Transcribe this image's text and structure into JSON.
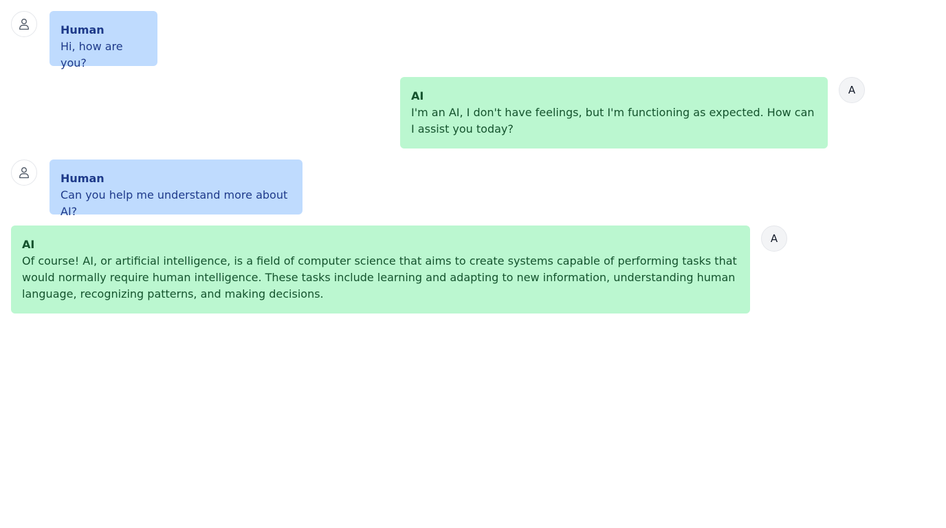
{
  "messages": [
    {
      "role": "human",
      "sender": "Human",
      "text": "Hi, how are you?",
      "avatar_icon": "user-icon"
    },
    {
      "role": "ai",
      "sender": "AI",
      "text": "I'm an AI, I don't have feelings, but I'm functioning as expected. How can I assist you today?",
      "avatar_letter": "A"
    },
    {
      "role": "human",
      "sender": "Human",
      "text": "Can you help me understand more about AI?",
      "avatar_icon": "user-icon"
    },
    {
      "role": "ai",
      "sender": "AI",
      "text": "Of course! AI, or artificial intelligence, is a field of computer science that aims to create systems capable of performing tasks that would normally require human intelligence. These tasks include learning and adapting to new information, understanding human language, recognizing patterns, and making decisions.",
      "avatar_letter": "A"
    }
  ],
  "colors": {
    "human_bubble": "#bfdbfe",
    "human_text": "#1e3a8a",
    "ai_bubble": "#bbf7d0",
    "ai_text": "#14532d"
  }
}
